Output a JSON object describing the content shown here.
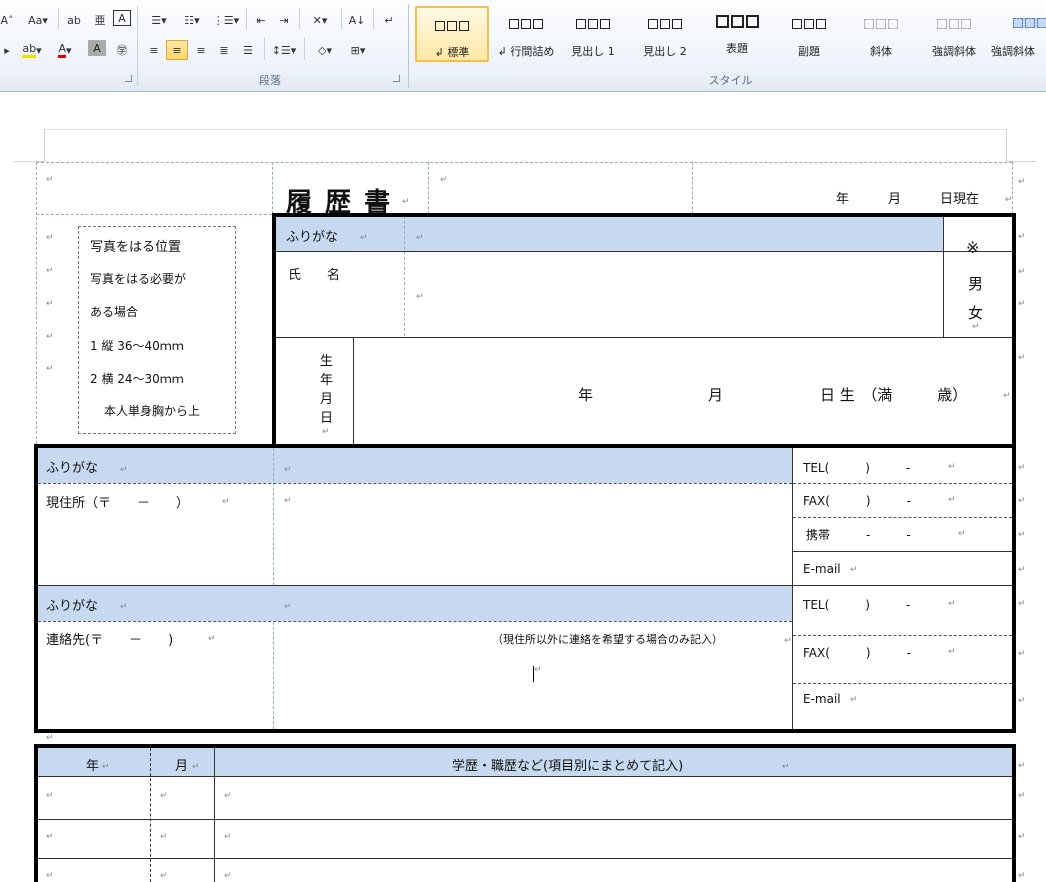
{
  "ribbon": {
    "aa_label": "Aa",
    "paragraph_group_label": "段落",
    "styles_group_label": "スタイル",
    "styles": [
      {
        "name": "標準",
        "mark": "↲",
        "active": true
      },
      {
        "name": "行間詰め",
        "mark": "↲",
        "active": false
      },
      {
        "name": "見出し 1",
        "mark": "",
        "active": false
      },
      {
        "name": "見出し 2",
        "mark": "",
        "active": false
      },
      {
        "name": "表題",
        "mark": "",
        "active": false
      },
      {
        "name": "副題",
        "mark": "",
        "active": false
      },
      {
        "name": "斜体",
        "mark": "",
        "active": false
      },
      {
        "name": "強調斜体",
        "mark": "",
        "active": false
      },
      {
        "name": "強調斜体",
        "mark": "",
        "active": false
      }
    ],
    "accent_color": "#f4c04a"
  },
  "form": {
    "title": "履 歴 書",
    "date_now": "年　　　月　　　日現在",
    "photo": {
      "title": "写真をはる位置",
      "line1": "写真をはる必要が",
      "line2": "ある場合",
      "line3": "1 縦 36～40ｍｍ",
      "line4": "2 横 24～30ｍｍ",
      "line5": "本人単身胸から上"
    },
    "furigana": "ふりがな",
    "name_label": "氏　　名",
    "gender_mark": "※",
    "gender_male": "男",
    "gender_female": "女",
    "birth_label_chars": [
      "生",
      "年",
      "月",
      "日"
    ],
    "birth_year": "年",
    "birth_month": "月",
    "birth_day_age": "日 生　（満　　　歳）",
    "address_label": "現住所（〒　　－　　）",
    "contact_label": "連絡先(〒　　－　　)",
    "contact_note": "（現住所以外に連絡を希望する場合のみ記入）",
    "tel": "TEL(　　　)　　　-",
    "fax": "FAX(　　　)　　　-",
    "mobile": "携帯　　　-　　　-",
    "email": "E-mail",
    "history_header": {
      "year": "年",
      "month": "月",
      "content": "学歴・職歴など(項目別にまとめて記入)"
    },
    "header_fill_color": "#c6d9f0"
  }
}
